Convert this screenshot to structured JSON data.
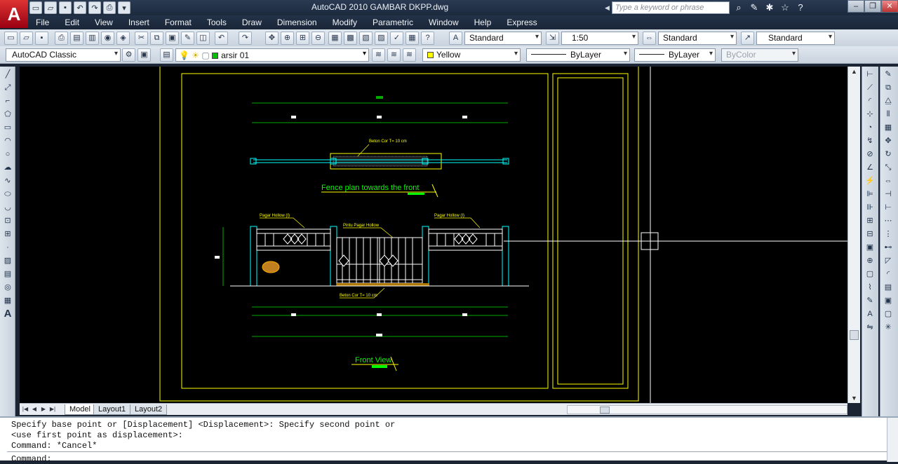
{
  "app": {
    "logo_letter": "A",
    "title": "AutoCAD 2010     GAMBAR DKPP.dwg",
    "search_placeholder": "Type a keyword or phrase"
  },
  "menu": [
    "File",
    "Edit",
    "View",
    "Insert",
    "Format",
    "Tools",
    "Draw",
    "Dimension",
    "Modify",
    "Parametric",
    "Window",
    "Help",
    "Express"
  ],
  "styles": {
    "text_style": "Standard",
    "dim_scale": "1:50",
    "dim_style": "Standard",
    "multileader_style": "Standard"
  },
  "workspace": "AutoCAD Classic",
  "layer": "arsir 01",
  "properties": {
    "color": "Yellow",
    "color_hex": "#ffff00",
    "linetype": "ByLayer",
    "lineweight": "ByLayer",
    "plotstyle": "ByColor"
  },
  "drawing": {
    "plan_label": "Beton Cor T= 10 cm",
    "plan_title": "Fence plan towards the front",
    "front_label_left": "Pagar Hollow (I)",
    "front_label_mid": "Pintu Pagar Hollow",
    "front_label_right": "Pagar Hollow (I)",
    "front_label_bottom": "Beton Cor T= 10 cm",
    "front_title": "Front View"
  },
  "tabs": {
    "model": "Model",
    "layout1": "Layout1",
    "layout2": "Layout2"
  },
  "command": {
    "line1": "Specify base point or [Displacement] <Displacement>: Specify second point or",
    "line2": "<use first point as displacement>:",
    "line3": "Command: *Cancel*",
    "prompt": "Command:"
  }
}
